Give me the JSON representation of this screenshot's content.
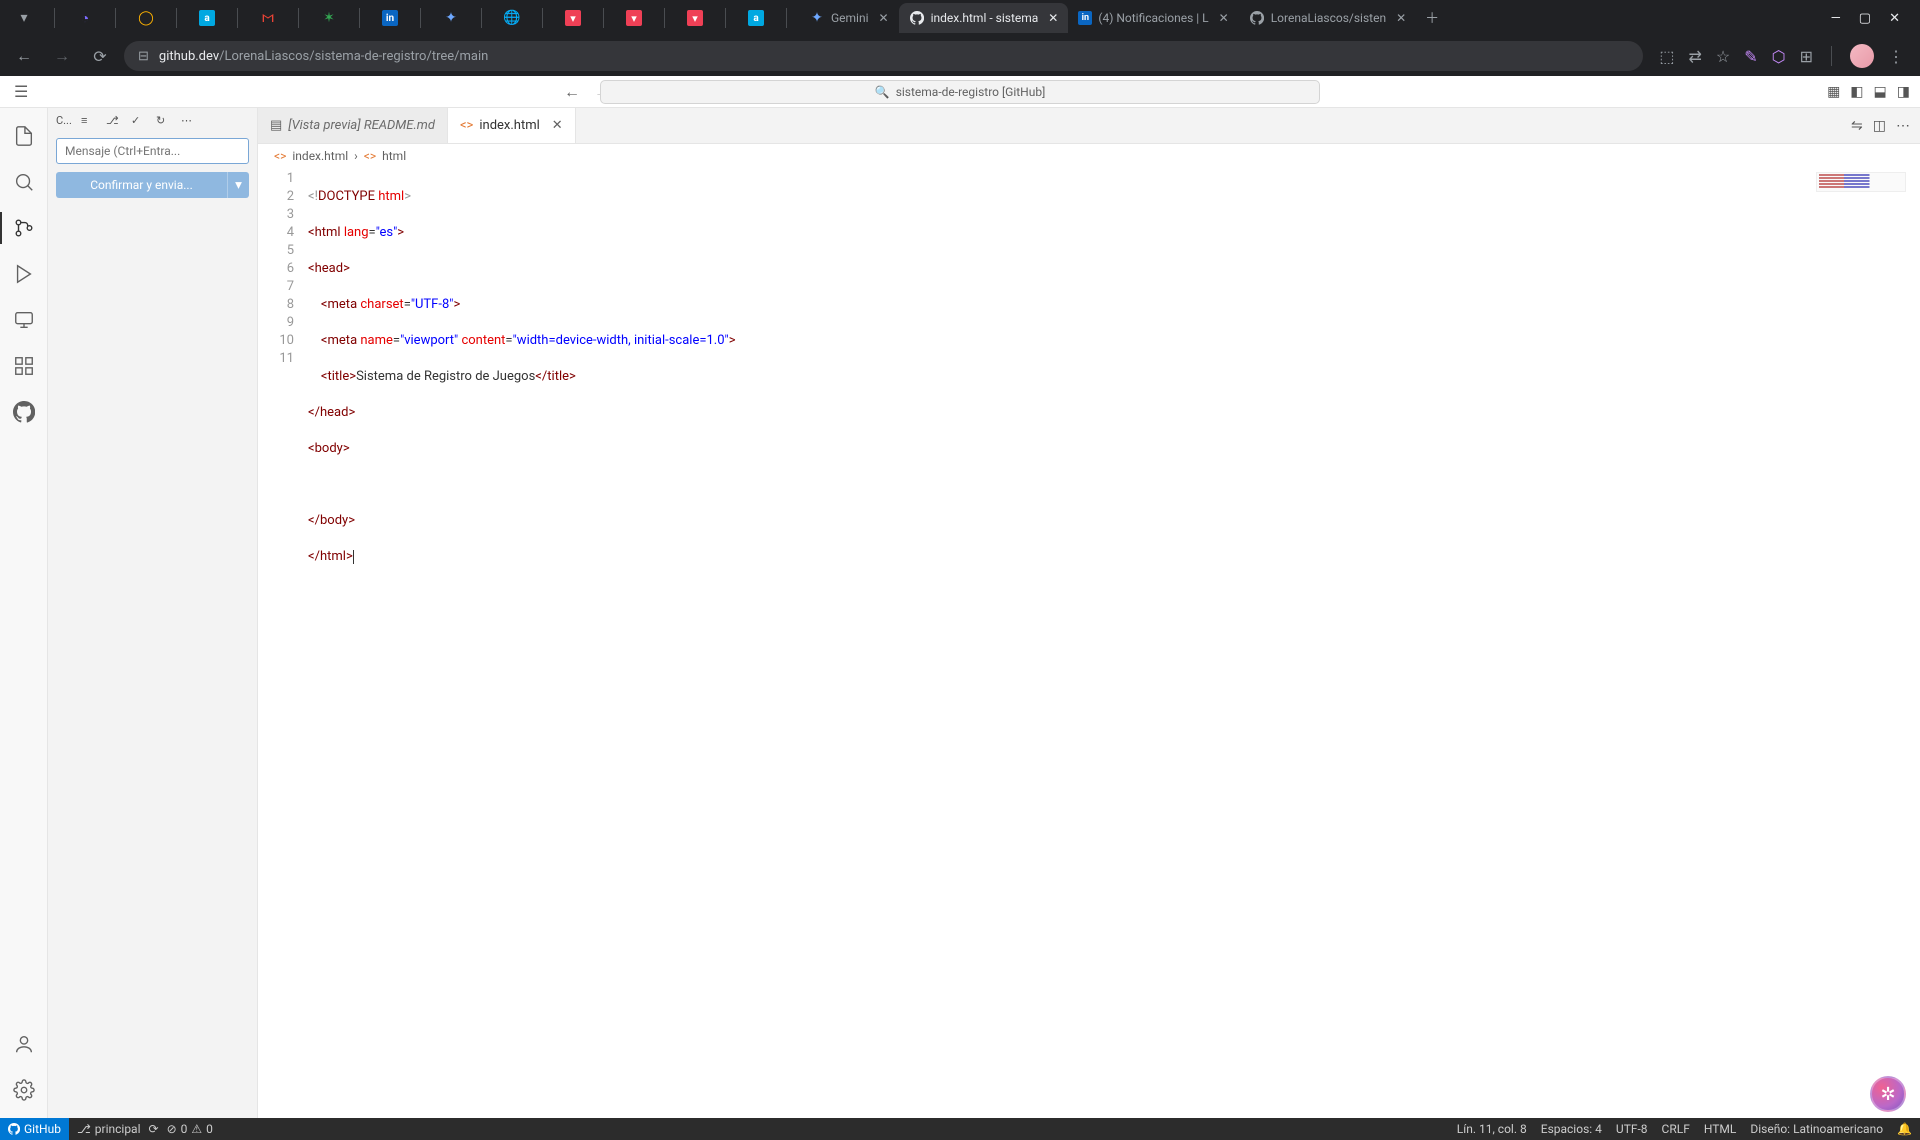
{
  "browser": {
    "tabs": [
      {
        "label": "Gemini"
      },
      {
        "label": "index.html - sistema",
        "active": true
      },
      {
        "label": "(4) Notificaciones | L"
      },
      {
        "label": "LorenaLiascos/sisten"
      }
    ],
    "url_prefix": "github.dev",
    "url_path": "/LorenaLiascos/sistema-de-registro/tree/main"
  },
  "top": {
    "command_center": "sistema-de-registro [GitHub]"
  },
  "scm": {
    "header_abbrev": "C...",
    "commit_placeholder": "Mensaje (Ctrl+Entra...",
    "commit_button": "Confirmar y envia..."
  },
  "editor": {
    "tabs": [
      {
        "label": "[Vista previa] README.md",
        "icon": "preview",
        "active": false
      },
      {
        "label": "index.html",
        "icon": "html",
        "active": true
      }
    ],
    "breadcrumb": {
      "file": "index.html",
      "symbol": "html"
    },
    "lines": [
      "1",
      "2",
      "3",
      "4",
      "5",
      "6",
      "7",
      "8",
      "9",
      "10",
      "11"
    ],
    "code": {
      "title_text": "Sistema de Registro de Juegos"
    }
  },
  "status": {
    "github": "GitHub",
    "branch": "principal",
    "problems": "0",
    "warnings": "0",
    "line_col": "Lín. 11, col. 8",
    "spaces": "Espacios: 4",
    "encoding": "UTF-8",
    "eol": "CRLF",
    "language": "HTML",
    "layout": "Diseño: Latinoamericano"
  }
}
